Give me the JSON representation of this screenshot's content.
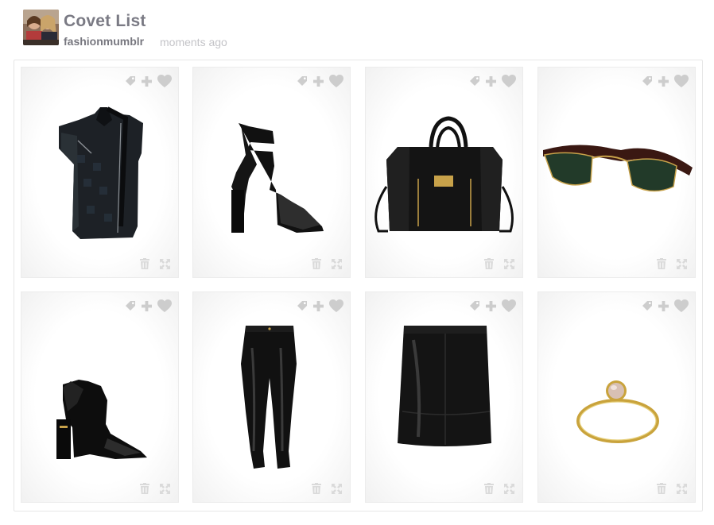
{
  "header": {
    "title": "Covet List",
    "username": "fashionmumblr",
    "time": "moments ago"
  },
  "board": {
    "items": [
      {
        "kind": "vest",
        "label": "black leather moto vest"
      },
      {
        "kind": "heels",
        "label": "black cut-out block heel pumps"
      },
      {
        "kind": "bag",
        "label": "black leather satchel bag"
      },
      {
        "kind": "sunglasses",
        "label": "clubmaster sunglasses"
      },
      {
        "kind": "ankle-boots",
        "label": "black pointed ankle boots"
      },
      {
        "kind": "leggings",
        "label": "black leather leggings"
      },
      {
        "kind": "skirt",
        "label": "black leather mini skirt"
      },
      {
        "kind": "ring",
        "label": "gold ring with pink stone"
      }
    ],
    "card_icons": [
      "tag-icon",
      "plus-icon",
      "heart-icon",
      "trash-icon",
      "expand-icon"
    ]
  },
  "colors": {
    "title": "#7a7a84",
    "username": "#77777f",
    "time": "#c4c4c8",
    "icon": "#cdcdcd"
  }
}
